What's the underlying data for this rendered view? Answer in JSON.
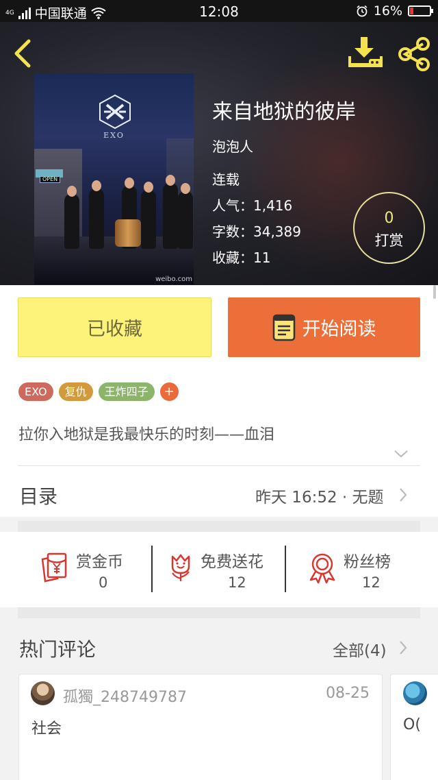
{
  "status_bar": {
    "carrier_prefix": "4G",
    "carrier": "中国联通",
    "time": "12:08",
    "battery": "16%",
    "icons": [
      "signal-icon",
      "wifi-icon",
      "alarm-icon",
      "battery-icon"
    ]
  },
  "header": {
    "back_icon": "chevron-left-icon",
    "download_icon": "download-icon",
    "share_icon": "share-icon",
    "cover": {
      "brand": "EXO",
      "watermark": "weibo.com",
      "sign": "OPEN"
    }
  },
  "book": {
    "title": "来自地狱的彼岸",
    "author": "泡泡人",
    "status": "连载",
    "popularity": "人气：1,416",
    "word_count": "字数：34,389",
    "favorites": "收藏：11"
  },
  "reward": {
    "count": "0",
    "label": "打赏"
  },
  "actions": {
    "favorited_label": "已收藏",
    "read_label": "开始阅读"
  },
  "tags": [
    "EXO",
    "复仇",
    "王炸四子"
  ],
  "tag_add": "+",
  "summary": "拉你入地狱是我最快乐的时刻——血泪",
  "toc": {
    "label": "目录",
    "latest": "昨天 16:52 · 无题"
  },
  "stats": [
    {
      "label": "赏金币",
      "value": "0",
      "icon": "red-packet-icon"
    },
    {
      "label": "免费送花",
      "value": "12",
      "icon": "flower-icon"
    },
    {
      "label": "粉丝榜",
      "value": "12",
      "icon": "medal-icon"
    }
  ],
  "comments_section": {
    "title": "热门评论",
    "all": "全部(4)"
  },
  "comments": [
    {
      "user": "孤獨_248749787",
      "date": "08-25",
      "text": "社会"
    },
    {
      "user": "",
      "date": "",
      "text": "O("
    }
  ],
  "colors": {
    "accent_orange": "#ec6e39",
    "favorited_yellow": "#fdf27a",
    "reward_gold": "#f2e98a",
    "icon_red": "#d9362f",
    "header_icon_gold": "#f5e24f"
  }
}
